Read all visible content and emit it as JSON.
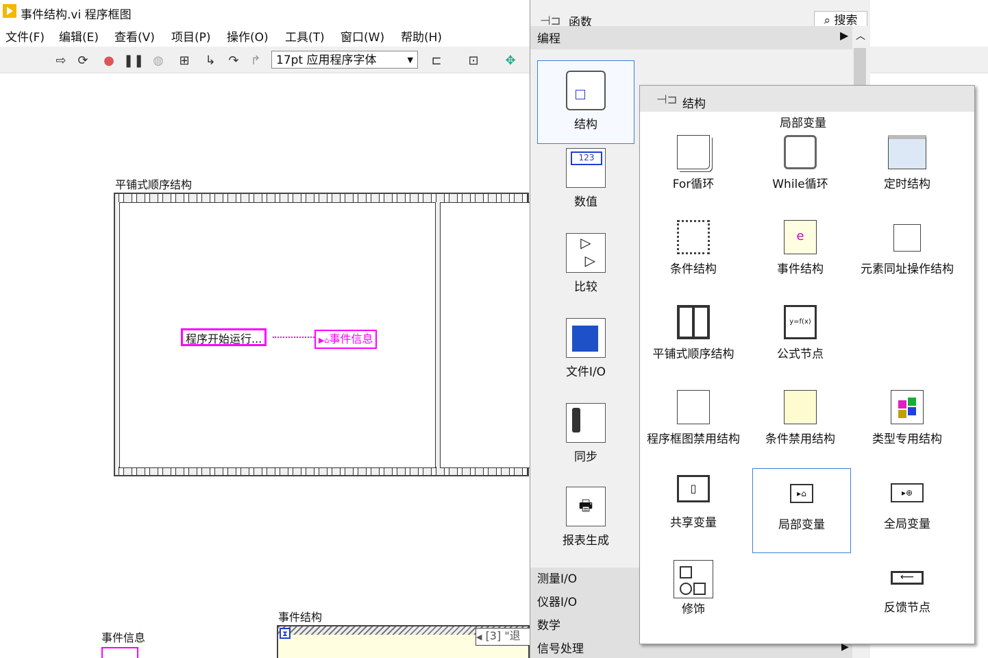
{
  "window": {
    "title": "事件结构.vi 程序框图"
  },
  "menu": [
    "文件(F)",
    "编辑(E)",
    "查看(V)",
    "项目(P)",
    "操作(O)",
    "工具(T)",
    "窗口(W)",
    "帮助(H)"
  ],
  "toolbar": {
    "font": "17pt 应用程序字体"
  },
  "diagram": {
    "flat_seq_label": "平铺式顺序结构",
    "string_const": "程序开始运行...",
    "local_var": "事件信息",
    "event_info_label": "事件信息",
    "event_struct_label": "事件结构",
    "case_selector": "[3] \"退"
  },
  "palette": {
    "title": "函数",
    "search": "搜索",
    "category": "编程",
    "items": [
      {
        "label": "结构"
      },
      {
        "label": "数值"
      },
      {
        "label": "比较"
      },
      {
        "label": "文件I/O"
      },
      {
        "label": "同步"
      },
      {
        "label": "报表生成"
      }
    ],
    "numeric_icon_text": "123",
    "bottom_categories": [
      "测量I/O",
      "仪器I/O",
      "数学",
      "信号处理"
    ]
  },
  "subpalette": {
    "title": "结构",
    "tooltip": "局部变量",
    "items": [
      {
        "label": "For循环"
      },
      {
        "label": "While循环"
      },
      {
        "label": "定时结构"
      },
      {
        "label": "条件结构"
      },
      {
        "label": "事件结构"
      },
      {
        "label": "元素同址操作结构"
      },
      {
        "label": "平铺式顺序结构"
      },
      {
        "label": "公式节点"
      },
      {
        "label": "程序框图禁用结构"
      },
      {
        "label": "条件禁用结构"
      },
      {
        "label": "类型专用结构"
      },
      {
        "label": "共享变量"
      },
      {
        "label": "局部变量"
      },
      {
        "label": "全局变量"
      },
      {
        "label": "修饰"
      },
      {
        "label": "反馈节点"
      }
    ],
    "formula_icon_text": "y=f(x)"
  }
}
